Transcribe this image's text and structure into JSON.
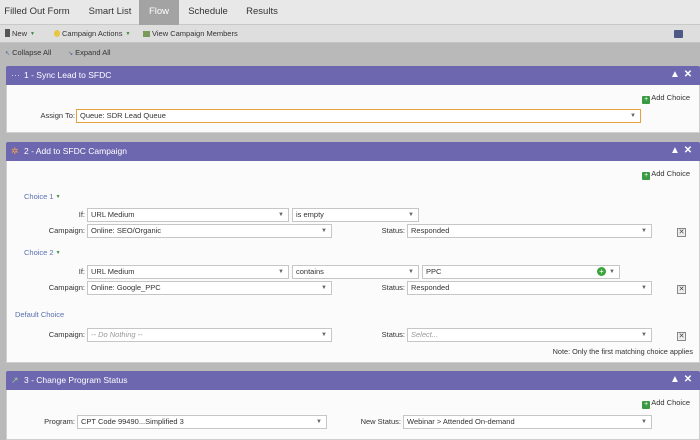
{
  "tabs": [
    "Filled Out Form",
    "Smart List",
    "Flow",
    "Schedule",
    "Results"
  ],
  "active_tab": "Flow",
  "toolbar": {
    "new_label": "New",
    "campaign_actions_label": "Campaign Actions",
    "view_members_label": "View Campaign Members"
  },
  "collapse": {
    "collapse_all": "Collapse All",
    "expand_all": "Expand All"
  },
  "add_choice_label": "Add Choice",
  "steps": [
    {
      "title": "1 - Sync Lead to SFDC",
      "assign_to_label": "Assign To:",
      "assign_to_value": "Queue: SDR Lead Queue"
    },
    {
      "title": "2 - Add to SFDC Campaign",
      "choices": [
        {
          "label": "Choice 1",
          "if_label": "If:",
          "field": "URL Medium",
          "operator": "is empty",
          "campaign_label": "Campaign:",
          "campaign": "Online: SEO/Organic",
          "status_label": "Status:",
          "status": "Responded"
        },
        {
          "label": "Choice 2",
          "if_label": "If:",
          "field": "URL Medium",
          "operator": "contains",
          "value": "PPC",
          "campaign_label": "Campaign:",
          "campaign": "Online: Google_PPC",
          "status_label": "Status:",
          "status": "Responded"
        }
      ],
      "default_choice": {
        "label": "Default Choice",
        "campaign_label": "Campaign:",
        "campaign": "-- Do Nothing --",
        "status_label": "Status:",
        "status": "Select..."
      },
      "note": "Note: Only the first matching choice applies"
    },
    {
      "title": "3 - Change Program Status",
      "program_label": "Program:",
      "program": "CPT Code 99490...Simplified 3",
      "new_status_label": "New Status:",
      "new_status": "Webinar > Attended On-demand"
    }
  ]
}
